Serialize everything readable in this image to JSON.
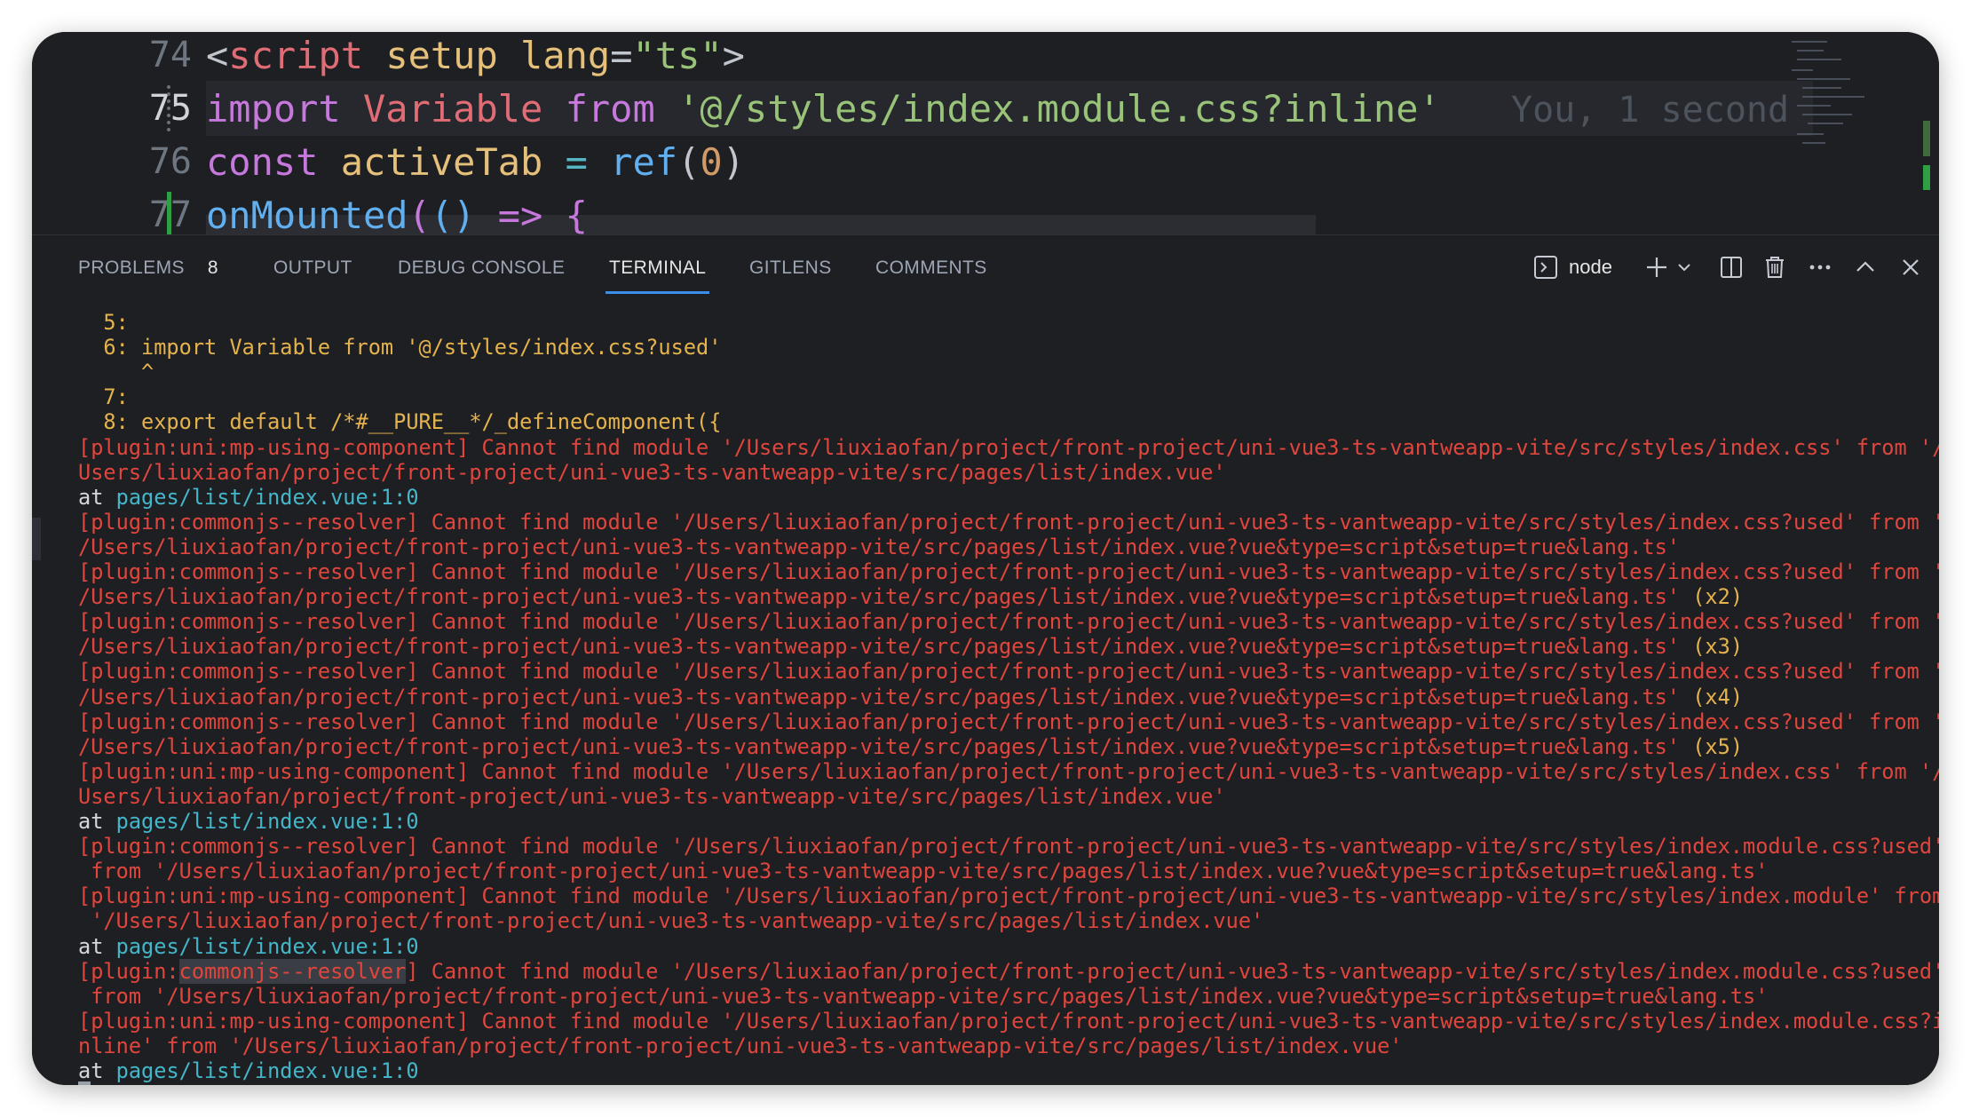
{
  "editor": {
    "lines": [
      {
        "num": "74",
        "tokens": [
          {
            "t": "<",
            "c": "punc"
          },
          {
            "t": "script",
            "c": "tag"
          },
          {
            "t": " ",
            "c": "punc"
          },
          {
            "t": "setup",
            "c": "attr"
          },
          {
            "t": " ",
            "c": "punc"
          },
          {
            "t": "lang",
            "c": "attr"
          },
          {
            "t": "=",
            "c": "punc"
          },
          {
            "t": "\"ts\"",
            "c": "str"
          },
          {
            "t": ">",
            "c": "punc"
          }
        ]
      },
      {
        "num": "75",
        "active": true,
        "tokens": [
          {
            "t": "import",
            "c": "kw"
          },
          {
            "t": " ",
            "c": "punc"
          },
          {
            "t": "Variable",
            "c": "var"
          },
          {
            "t": " ",
            "c": "punc"
          },
          {
            "t": "from",
            "c": "kw"
          },
          {
            "t": " ",
            "c": "punc"
          },
          {
            "t": "'@/styles/index.module.css?inline'",
            "c": "str"
          }
        ]
      },
      {
        "num": "76",
        "tokens": [
          {
            "t": "const",
            "c": "kw"
          },
          {
            "t": " ",
            "c": "punc"
          },
          {
            "t": "activeTab",
            "c": "def"
          },
          {
            "t": " ",
            "c": "punc"
          },
          {
            "t": "=",
            "c": "op"
          },
          {
            "t": " ",
            "c": "punc"
          },
          {
            "t": "ref",
            "c": "fn"
          },
          {
            "t": "(",
            "c": "punc"
          },
          {
            "t": "0",
            "c": "num"
          },
          {
            "t": ")",
            "c": "punc"
          }
        ]
      },
      {
        "num": "77",
        "tokens": [
          {
            "t": "onMounted",
            "c": "fn"
          },
          {
            "t": "(",
            "c": "kw"
          },
          {
            "t": "()",
            "c": "fn"
          },
          {
            "t": " ",
            "c": "punc"
          },
          {
            "t": "=>",
            "c": "kw"
          },
          {
            "t": " ",
            "c": "punc"
          },
          {
            "t": "{",
            "c": "kw"
          }
        ]
      }
    ],
    "blame": "You, 1 second"
  },
  "panel": {
    "tabs": [
      {
        "label": "PROBLEMS",
        "badge": "8"
      },
      {
        "label": "OUTPUT"
      },
      {
        "label": "DEBUG CONSOLE"
      },
      {
        "label": "TERMINAL",
        "active": true
      },
      {
        "label": "GITLENS"
      },
      {
        "label": "COMMENTS"
      }
    ],
    "shell": "node"
  },
  "terminal": {
    "lines": [
      [
        {
          "t": "  5:",
          "c": "yellow"
        }
      ],
      [
        {
          "t": "  6: import Variable from '@/styles/index.css?used'",
          "c": "yellow"
        }
      ],
      [
        {
          "t": "     ^",
          "c": "yellow"
        }
      ],
      [
        {
          "t": "  7:",
          "c": "yellow"
        }
      ],
      [
        {
          "t": "  8: export default /*#__PURE__*/_defineComponent({",
          "c": "yellow"
        }
      ],
      [
        {
          "t": "[plugin:uni:mp-using-component] Cannot find module '/Users/liuxiaofan/project/front-project/uni-vue3-ts-vantweapp-vite/src/styles/index.css' from '/",
          "c": "red"
        }
      ],
      [
        {
          "t": "Users/liuxiaofan/project/front-project/uni-vue3-ts-vantweapp-vite/src/pages/list/index.vue'",
          "c": "red"
        }
      ],
      [
        {
          "t": "at ",
          "c": "white"
        },
        {
          "t": "pages/list/index.vue:1:0",
          "c": "cyan"
        }
      ],
      [
        {
          "t": "[plugin:commonjs--resolver] Cannot find module '/Users/liuxiaofan/project/front-project/uni-vue3-ts-vantweapp-vite/src/styles/index.css?used' from '",
          "c": "red"
        }
      ],
      [
        {
          "t": "/Users/liuxiaofan/project/front-project/uni-vue3-ts-vantweapp-vite/src/pages/list/index.vue?vue&type=script&setup=true&lang.ts'",
          "c": "red"
        }
      ],
      [
        {
          "t": "[plugin:commonjs--resolver] Cannot find module '/Users/liuxiaofan/project/front-project/uni-vue3-ts-vantweapp-vite/src/styles/index.css?used' from '",
          "c": "red"
        }
      ],
      [
        {
          "t": "/Users/liuxiaofan/project/front-project/uni-vue3-ts-vantweapp-vite/src/pages/list/index.vue?vue&type=script&setup=true&lang.ts'",
          "c": "red"
        },
        {
          "t": " (x2)",
          "c": "yellow"
        }
      ],
      [
        {
          "t": "[plugin:commonjs--resolver] Cannot find module '/Users/liuxiaofan/project/front-project/uni-vue3-ts-vantweapp-vite/src/styles/index.css?used' from '",
          "c": "red"
        }
      ],
      [
        {
          "t": "/Users/liuxiaofan/project/front-project/uni-vue3-ts-vantweapp-vite/src/pages/list/index.vue?vue&type=script&setup=true&lang.ts'",
          "c": "red"
        },
        {
          "t": " (x3)",
          "c": "yellow"
        }
      ],
      [
        {
          "t": "[plugin:commonjs--resolver] Cannot find module '/Users/liuxiaofan/project/front-project/uni-vue3-ts-vantweapp-vite/src/styles/index.css?used' from '",
          "c": "red"
        }
      ],
      [
        {
          "t": "/Users/liuxiaofan/project/front-project/uni-vue3-ts-vantweapp-vite/src/pages/list/index.vue?vue&type=script&setup=true&lang.ts'",
          "c": "red"
        },
        {
          "t": " (x4)",
          "c": "yellow"
        }
      ],
      [
        {
          "t": "[plugin:commonjs--resolver] Cannot find module '/Users/liuxiaofan/project/front-project/uni-vue3-ts-vantweapp-vite/src/styles/index.css?used' from '",
          "c": "red"
        }
      ],
      [
        {
          "t": "/Users/liuxiaofan/project/front-project/uni-vue3-ts-vantweapp-vite/src/pages/list/index.vue?vue&type=script&setup=true&lang.ts'",
          "c": "red"
        },
        {
          "t": " (x5)",
          "c": "yellow"
        }
      ],
      [
        {
          "t": "[plugin:uni:mp-using-component] Cannot find module '/Users/liuxiaofan/project/front-project/uni-vue3-ts-vantweapp-vite/src/styles/index.css' from '/",
          "c": "red"
        }
      ],
      [
        {
          "t": "Users/liuxiaofan/project/front-project/uni-vue3-ts-vantweapp-vite/src/pages/list/index.vue'",
          "c": "red"
        }
      ],
      [
        {
          "t": "at ",
          "c": "white"
        },
        {
          "t": "pages/list/index.vue:1:0",
          "c": "cyan"
        }
      ],
      [
        {
          "t": "[plugin:commonjs--resolver] Cannot find module '/Users/liuxiaofan/project/front-project/uni-vue3-ts-vantweapp-vite/src/styles/index.module.css?used'",
          "c": "red"
        }
      ],
      [
        {
          "t": " from '/Users/liuxiaofan/project/front-project/uni-vue3-ts-vantweapp-vite/src/pages/list/index.vue?vue&type=script&setup=true&lang.ts'",
          "c": "red"
        }
      ],
      [
        {
          "t": "[plugin:uni:mp-using-component] Cannot find module '/Users/liuxiaofan/project/front-project/uni-vue3-ts-vantweapp-vite/src/styles/index.module' from",
          "c": "red"
        }
      ],
      [
        {
          "t": " '/Users/liuxiaofan/project/front-project/uni-vue3-ts-vantweapp-vite/src/pages/list/index.vue'",
          "c": "red"
        }
      ],
      [
        {
          "t": "at ",
          "c": "white"
        },
        {
          "t": "pages/list/index.vue:1:0",
          "c": "cyan"
        }
      ],
      [
        {
          "t": "[plugin:",
          "c": "red"
        },
        {
          "t": "commonjs--resolver",
          "c": "red",
          "sel": true
        },
        {
          "t": "] Cannot find module '/Users/liuxiaofan/project/front-project/uni-vue3-ts-vantweapp-vite/src/styles/index.module.css?used'",
          "c": "red"
        }
      ],
      [
        {
          "t": " from '/Users/liuxiaofan/project/front-project/uni-vue3-ts-vantweapp-vite/src/pages/list/index.vue?vue&type=script&setup=true&lang.ts'",
          "c": "red"
        }
      ],
      [
        {
          "t": "[plugin:uni:mp-using-component] Cannot find module '/Users/liuxiaofan/project/front-project/uni-vue3-ts-vantweapp-vite/src/styles/index.module.css?i",
          "c": "red"
        }
      ],
      [
        {
          "t": "nline' from '/Users/liuxiaofan/project/front-project/uni-vue3-ts-vantweapp-vite/src/pages/list/index.vue'",
          "c": "red"
        }
      ],
      [
        {
          "t": "at ",
          "c": "white"
        },
        {
          "t": "pages/list/index.vue:1:0",
          "c": "cyan"
        }
      ]
    ]
  }
}
